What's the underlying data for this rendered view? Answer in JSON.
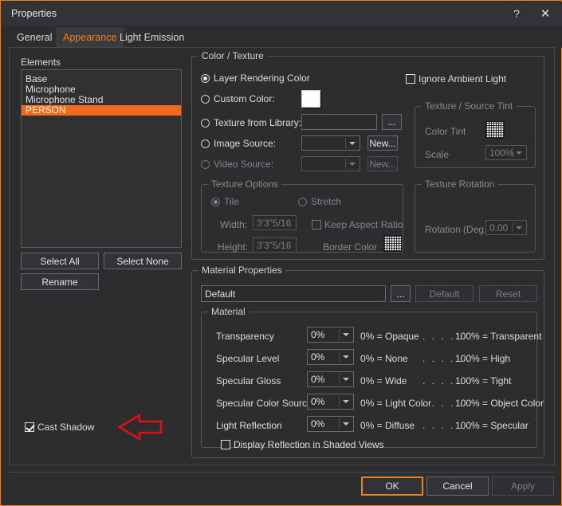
{
  "window": {
    "title": "Properties",
    "help_icon": "?",
    "close_icon": "✕",
    "accent_color": "#e8821e",
    "background_color": "#2d2d30"
  },
  "tabs": [
    {
      "label": "General",
      "active": false
    },
    {
      "label": "Appearance",
      "active": true
    },
    {
      "label": "Light Emission",
      "active": false
    }
  ],
  "elements_panel": {
    "legend": "Elements",
    "items": [
      {
        "label": "Base",
        "selected": false
      },
      {
        "label": "Microphone",
        "selected": false
      },
      {
        "label": "Microphone Stand",
        "selected": false
      },
      {
        "label": "PERSON",
        "selected": true
      }
    ],
    "selection_color": "#f26a1b",
    "buttons": {
      "select_all": "Select All",
      "select_none": "Select None",
      "rename": "Rename"
    },
    "cast_shadow": {
      "label": "Cast Shadow",
      "checked": true
    }
  },
  "color_texture": {
    "legend": "Color / Texture",
    "options": [
      {
        "label": "Layer Rendering Color",
        "selected": true,
        "enabled": true
      },
      {
        "label": "Custom Color:",
        "selected": false,
        "enabled": true
      },
      {
        "label": "Texture from Library:",
        "selected": false,
        "enabled": true
      },
      {
        "label": "Image Source:",
        "selected": false,
        "enabled": true
      },
      {
        "label": "Video Source:",
        "selected": false,
        "enabled": false
      }
    ],
    "custom_color_swatch": "#ffffff",
    "texture_library_value": "",
    "texture_library_browse": "...",
    "image_source_value": "",
    "image_source_new": "New...",
    "video_source_value": "",
    "video_source_new": "New...",
    "ignore_ambient_light": {
      "label": "Ignore Ambient Light",
      "checked": false
    }
  },
  "texture_source_tint": {
    "legend": "Texture / Source Tint",
    "color_tint_label": "Color Tint",
    "scale_label": "Scale",
    "scale_value": "100%",
    "enabled": false
  },
  "texture_options": {
    "legend": "Texture Options",
    "tile": {
      "label": "Tile",
      "selected": true
    },
    "stretch": {
      "label": "Stretch",
      "selected": false
    },
    "width_label": "Width:",
    "width_value": "3'3\"5/16",
    "height_label": "Height:",
    "height_value": "3'3\"5/16",
    "keep_aspect_ratio": {
      "label": "Keep Aspect Ratio",
      "checked": false
    },
    "border_color_label": "Border Color",
    "enabled": false
  },
  "texture_rotation": {
    "legend": "Texture Rotation",
    "rotation_label": "Rotation (Deg.)",
    "rotation_value": "0.00",
    "enabled": false
  },
  "material_properties": {
    "legend": "Material Properties",
    "name_value": "Default",
    "browse_label": "...",
    "default_label": "Default",
    "reset_label": "Reset",
    "material": {
      "legend": "Material",
      "rows": [
        {
          "label": "Transparency",
          "value": "0%",
          "low": "0% = Opaque",
          "dots": ". . . . .",
          "high": "100% = Transparent"
        },
        {
          "label": "Specular Level",
          "value": "0%",
          "low": "0% = None",
          "dots": ". . . . .",
          "high": "100% = High"
        },
        {
          "label": "Specular Gloss",
          "value": "0%",
          "low": "0% = Wide",
          "dots": ". . . . .",
          "high": "100% = Tight"
        },
        {
          "label": "Specular Color Source",
          "value": "0%",
          "low": "0% = Light Color",
          "dots": ". . . . .",
          "high": "100% = Object Color"
        },
        {
          "label": "Light Reflection",
          "value": "0%",
          "low": "0% = Diffuse",
          "dots": ". . . . .",
          "high": "100% = Specular"
        }
      ],
      "display_reflection": {
        "label": "Display Reflection in Shaded Views",
        "checked": false
      }
    }
  },
  "footer": {
    "ok": "OK",
    "cancel": "Cancel",
    "apply": "Apply"
  },
  "annotation": {
    "type": "left-arrow",
    "color": "#e01010"
  }
}
